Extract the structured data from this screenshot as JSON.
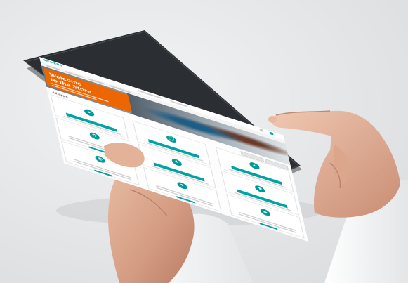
{
  "screen": {
    "logo": "SIEMENS",
    "hero": {
      "line1": "Welcome",
      "line2": "to the Store"
    },
    "section_title": "All apps",
    "cards": [
      {
        "title": "",
        "icon": "chat-icon"
      },
      {
        "title": "",
        "icon": "globe-icon"
      },
      {
        "title": "",
        "icon": "drop-icon"
      },
      {
        "title": "",
        "icon": "leaf-icon"
      },
      {
        "title": "",
        "icon": "star-icon"
      },
      {
        "title": "",
        "icon": "puzzle-icon"
      },
      {
        "title": "",
        "icon": "pin-icon"
      },
      {
        "title": "",
        "icon": "heart-icon"
      },
      {
        "title": "",
        "icon": "cloud-icon"
      }
    ]
  },
  "colors": {
    "accent": "#009999",
    "hero_orange": "#ec6602",
    "background": "#e6e7e8"
  }
}
